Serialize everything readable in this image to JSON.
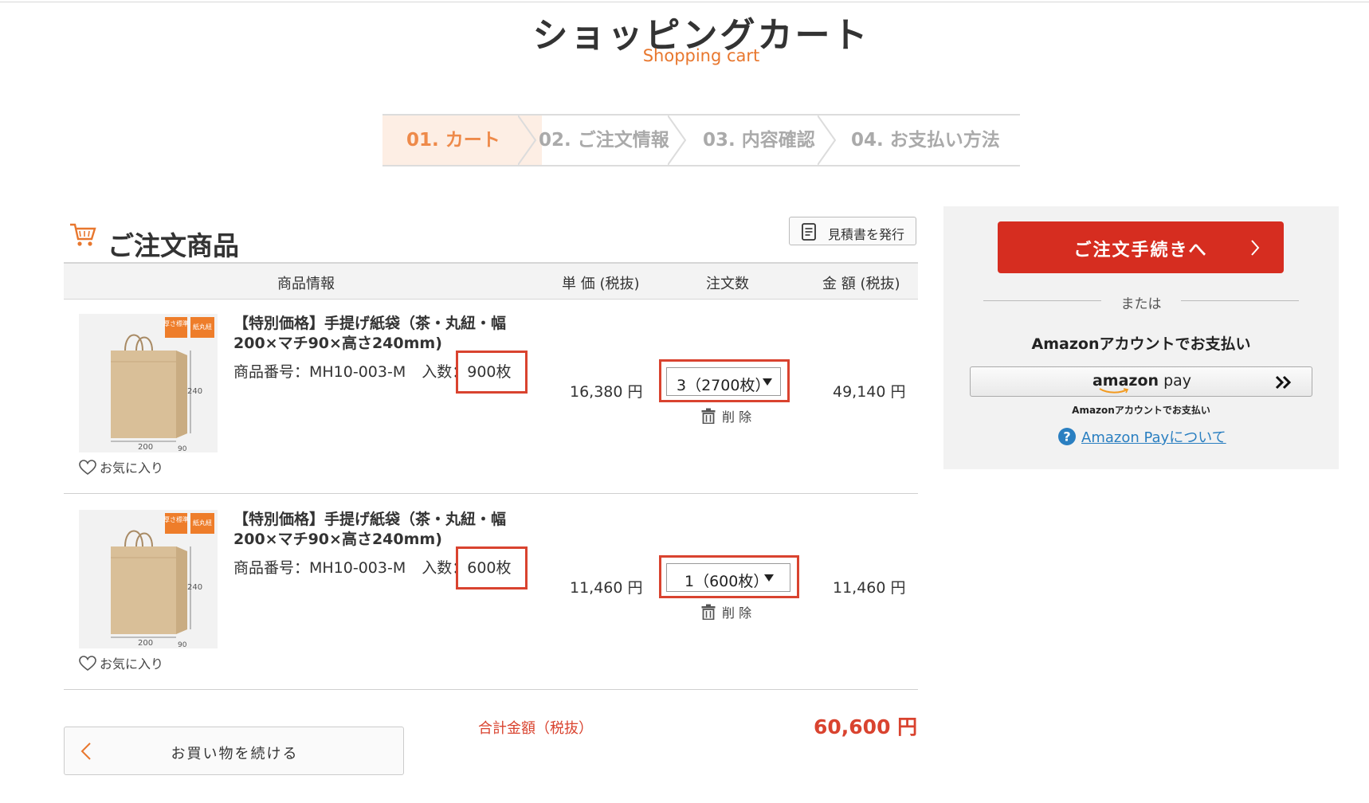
{
  "header": {
    "title": "ショッピングカート",
    "subtitle": "Shopping cart"
  },
  "steps": [
    {
      "label": "01. カート",
      "active": true
    },
    {
      "label": "02. ご注文情報",
      "active": false
    },
    {
      "label": "03. 内容確認",
      "active": false
    },
    {
      "label": "04. お支払い方法",
      "active": false
    }
  ],
  "section": {
    "title": "ご注文商品",
    "quote_button": "見積書を発行"
  },
  "table_header": {
    "product": "商品情報",
    "unit_price": "単 価 (税抜)",
    "quantity": "注文数",
    "amount": "金 額 (税抜)"
  },
  "items": [
    {
      "name": "【特別価格】手提げ紙袋（茶・丸紐・幅200×マチ90×高さ240mm)",
      "code_label": "商品番号：MH10-003-M",
      "irisu_label": "入数",
      "irisu_value": "：900枚",
      "unit_price": "16,380 円",
      "qty": "3（2700枚）",
      "delete": "削 除",
      "amount": "49,140 円",
      "favorite": "お気に入り",
      "thumb": {
        "tag1": "厚さ標準",
        "tag2": "紙丸紐",
        "w": "200",
        "h": "240",
        "d": "90"
      }
    },
    {
      "name": "【特別価格】手提げ紙袋（茶・丸紐・幅200×マチ90×高さ240mm)",
      "code_label": "商品番号：MH10-003-M",
      "irisu_label": "入数",
      "irisu_value": "：600枚",
      "unit_price": "11,460 円",
      "qty": "1（600枚）",
      "delete": "削 除",
      "amount": "11,460 円",
      "favorite": "お気に入り",
      "thumb": {
        "tag1": "厚さ標準",
        "tag2": "紙丸紐",
        "w": "200",
        "h": "240",
        "d": "90"
      }
    }
  ],
  "total": {
    "label": "合計金額（税抜）",
    "value": "60,600 円"
  },
  "continue_button": "お買い物を続ける",
  "sidebar": {
    "order_button": "ご注文手続きへ",
    "or_text": "または",
    "amazon_heading": "Amazonアカウントでお支払い",
    "amazon_button_logo_a": "amazon",
    "amazon_button_logo_b": " pay",
    "amazon_small": "Amazonアカウントでお支払い",
    "amazon_about": "Amazon Payについて"
  },
  "colors": {
    "accent": "#e8772e",
    "red": "#d62d20",
    "highlight": "#d9432f",
    "link": "#2a7fc1"
  }
}
